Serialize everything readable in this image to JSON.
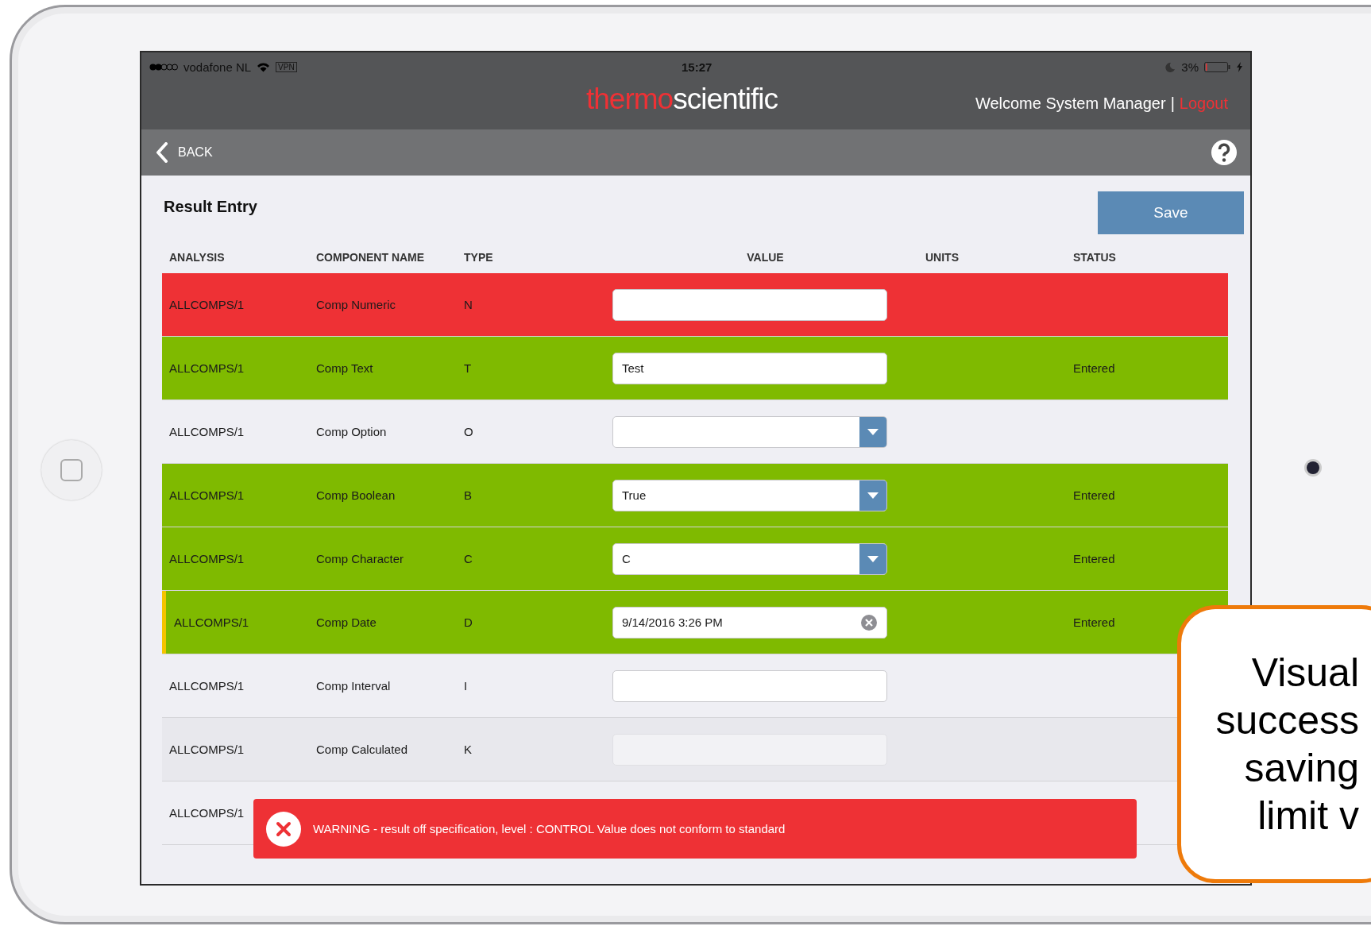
{
  "status_bar": {
    "carrier": "vodafone NL",
    "vpn": "VPN",
    "time": "15:27",
    "battery": "3%"
  },
  "header": {
    "logo": [
      "thermo",
      "scientific"
    ],
    "welcome": "Welcome System Manager",
    "separator": "|",
    "logout": "Logout"
  },
  "nav": {
    "back": "BACK"
  },
  "page": {
    "title": "Result Entry",
    "save": "Save"
  },
  "table": {
    "columns": [
      "ANALYSIS",
      "COMPONENT NAME",
      "TYPE",
      "VALUE",
      "UNITS",
      "STATUS"
    ],
    "rows": [
      {
        "analysis": "ALLCOMPS/1",
        "component": "Comp Numeric",
        "type": "N",
        "value": "",
        "kind": "text",
        "color": "#ee3135",
        "status": "",
        "selected": false
      },
      {
        "analysis": "ALLCOMPS/1",
        "component": "Comp Text",
        "type": "T",
        "value": "Test",
        "kind": "text",
        "color": "#7fba00",
        "status": "Entered",
        "selected": false
      },
      {
        "analysis": "ALLCOMPS/1",
        "component": "Comp Option",
        "type": "O",
        "value": "",
        "kind": "dropdown",
        "status": "",
        "selected": false
      },
      {
        "analysis": "ALLCOMPS/1",
        "component": "Comp Boolean",
        "type": "B",
        "value": "True",
        "kind": "dropdown",
        "color": "#7fba00",
        "status": "Entered",
        "selected": false
      },
      {
        "analysis": "ALLCOMPS/1",
        "component": "Comp Character",
        "type": "C",
        "value": "C",
        "kind": "dropdown",
        "color": "#7fba00",
        "status": "Entered",
        "selected": false
      },
      {
        "analysis": "ALLCOMPS/1",
        "component": "Comp Date",
        "type": "D",
        "value": "9/14/2016 3:26 PM",
        "kind": "date",
        "color": "#7fba00",
        "status": "Entered",
        "selected": true
      },
      {
        "analysis": "ALLCOMPS/1",
        "component": "Comp Interval",
        "type": "I",
        "value": "",
        "kind": "text",
        "status": "",
        "selected": false
      },
      {
        "analysis": "ALLCOMPS/1",
        "component": "Comp Calculated",
        "type": "K",
        "value": "",
        "kind": "disabled",
        "status": "",
        "selected": false
      },
      {
        "analysis": "ALLCOMPS/1",
        "component": "",
        "type": "",
        "value": "",
        "kind": "none",
        "status": "",
        "selected": false
      }
    ]
  },
  "toast": {
    "message": "WARNING - result off specification, level : CONTROL Value does not conform to standard"
  },
  "callout": {
    "lines": [
      "Visual",
      "success",
      "saving",
      "limit v"
    ]
  }
}
